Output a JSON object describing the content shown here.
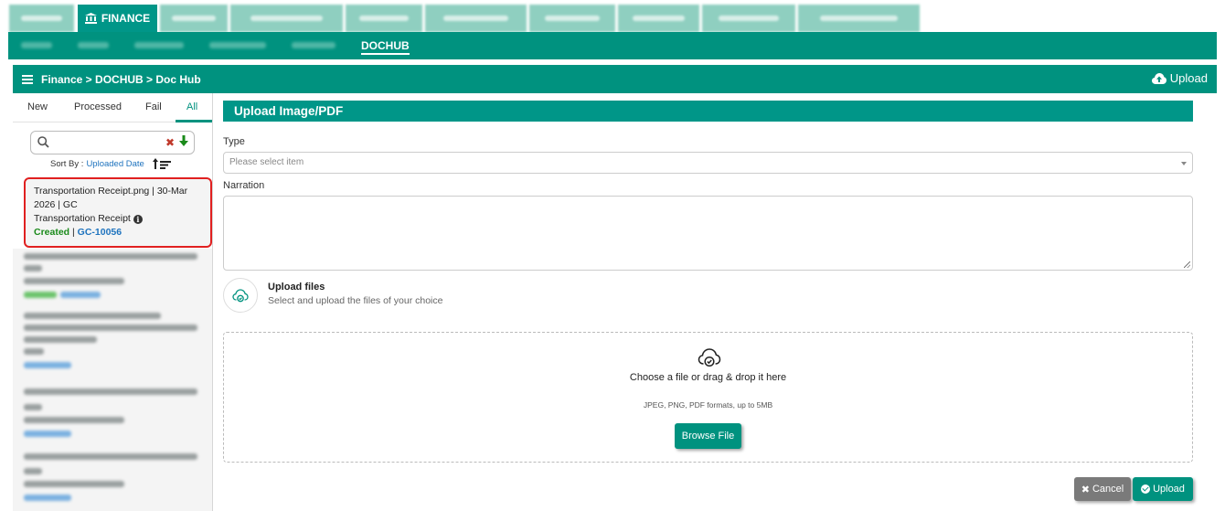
{
  "module_tabs": {
    "active_label": "FINANCE"
  },
  "submenu": {
    "active_label": "DOCHUB"
  },
  "breadcrumb": {
    "text": "Finance > DOCHUB > Doc Hub",
    "upload_label": "Upload"
  },
  "left_panel": {
    "tabs": [
      "New",
      "Processed",
      "Fail",
      "All"
    ],
    "active_tab": "All",
    "search": {
      "value": "",
      "placeholder": ""
    },
    "sort_label": "Sort By :",
    "sort_value": "Uploaded Date",
    "selected_card": {
      "line1": "Transportation Receipt.png | 30-Mar 2026 | GC",
      "line2": "Transportation Receipt",
      "status": "Created",
      "separator": " | ",
      "reference": "GC-10056"
    }
  },
  "form": {
    "section_title": "Upload Image/PDF",
    "type_label": "Type",
    "type_placeholder": "Please select item",
    "narration_label": "Narration",
    "upload_files_title": "Upload files",
    "upload_files_subtitle": "Select and upload the files of your choice",
    "dropzone_text": "Choose a file or drag & drop it here",
    "dropzone_formats": "JPEG, PNG, PDF formats, up to 5MB",
    "browse_label": "Browse File",
    "cancel_label": "Cancel",
    "upload_label": "Upload"
  },
  "colors": {
    "brand": "#00927f",
    "brand_light": "#009688",
    "status_created": "#1a8a1a",
    "reference_link": "#1e73be",
    "highlight_border": "#e02020"
  }
}
